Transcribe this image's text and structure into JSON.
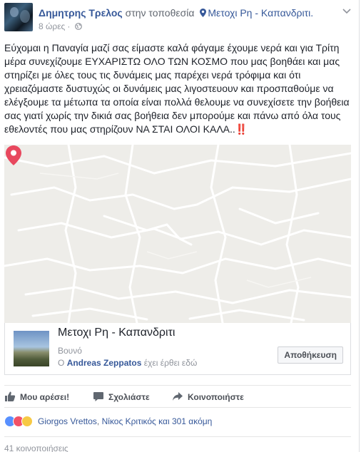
{
  "post": {
    "author": "Δημητρης Τρελος",
    "at_text": "στην τοποθεσία",
    "location": "Μετοχι Ρη - Καπανδριτι.",
    "time": "8 ώρες",
    "separator": "·",
    "text": "Εύχομαι η Παναγία μαζί σας είμαστε καλά φάγαμε έχουμε νερά και για Τρίτη μέρα συνεχίζουμε ΕΥΧΑΡΙΣΤΩ ΟΛΟ ΤΩΝ ΚΟΣΜΟ που μας βοηθάει και μας στηρίζει με όλες τους τις δυνάμεις μας παρέχει νερά τρόφιμα και ότι χρειαζόμαστε δυστυχώς οι δυνάμεις μας λιγοστευουν και προσπαθούμε να ελέγξουμε τα μέτωπα τα οποία είναι πολλά θελουμε να συνεχίσετε την βοήθεια σας γιατί χωρίς την δικιά σας βοήθεια δεν μπορούμε και πάνω από όλα τους εθελοντές που μας στηρίζουν ΝΑ ΣΤΑΙ ΟΛΟΙ ΚΑΛΑ..‼️"
  },
  "place_card": {
    "name": "Μετοχι Ρη - Καπανδριτι",
    "category": "Βουνό",
    "visitor_prefix": "O",
    "visitor": "Andreas Zeppatos",
    "visitor_suffix": "έχει έρθει εδώ",
    "save_label": "Αποθήκευση"
  },
  "actions": {
    "like": "Μου αρέσει!",
    "comment": "Σχολιάστε",
    "share": "Κοινοποιήστε"
  },
  "reactions": {
    "name1": "Giorgos Vrettos",
    "sep": ",",
    "name2": "Νίκος Κριτικός",
    "rest": "και 301 ακόμη"
  },
  "shares": "41 κοινοποιήσεις",
  "colors": {
    "link": "#365899",
    "pin": "#e8485e",
    "map_bg": "#eeede9"
  }
}
